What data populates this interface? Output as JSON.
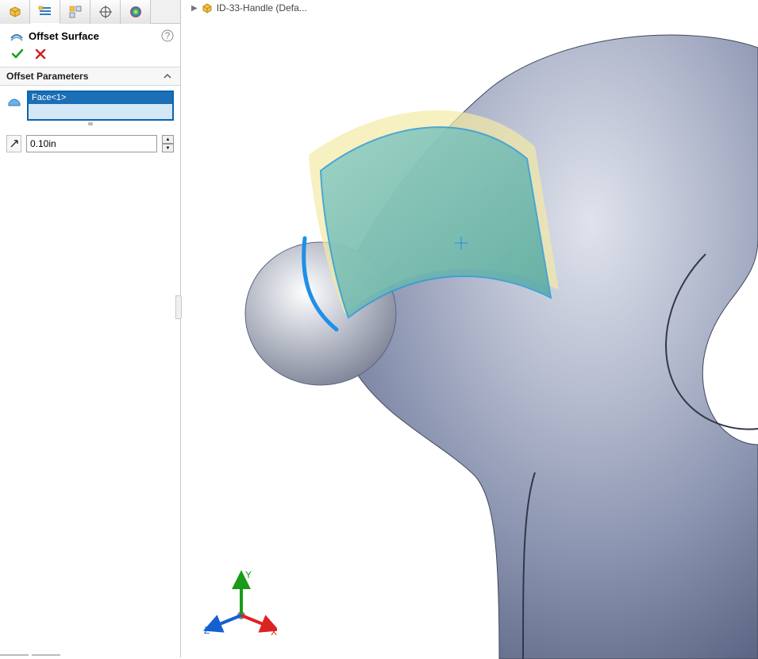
{
  "tabs": [
    "feature-manager",
    "property-manager",
    "config-manager",
    "dimxpert",
    "appearances"
  ],
  "feature": {
    "title": "Offset Surface",
    "help_tooltip": "Help"
  },
  "actions": {
    "ok": "OK",
    "cancel": "Cancel"
  },
  "section": {
    "title": "Offset Parameters"
  },
  "selection": {
    "items": [
      "Face<1>"
    ]
  },
  "offset": {
    "value": "0.10in"
  },
  "breadcrumb": {
    "part": "ID-33-Handle  (Defa..."
  },
  "triad": {
    "x": "X",
    "y": "Y",
    "z": "Z"
  },
  "colors": {
    "selectBlue": "#1a6fb5",
    "selectBorder": "#0a64ad",
    "panelBg": "#f7f7f7"
  }
}
